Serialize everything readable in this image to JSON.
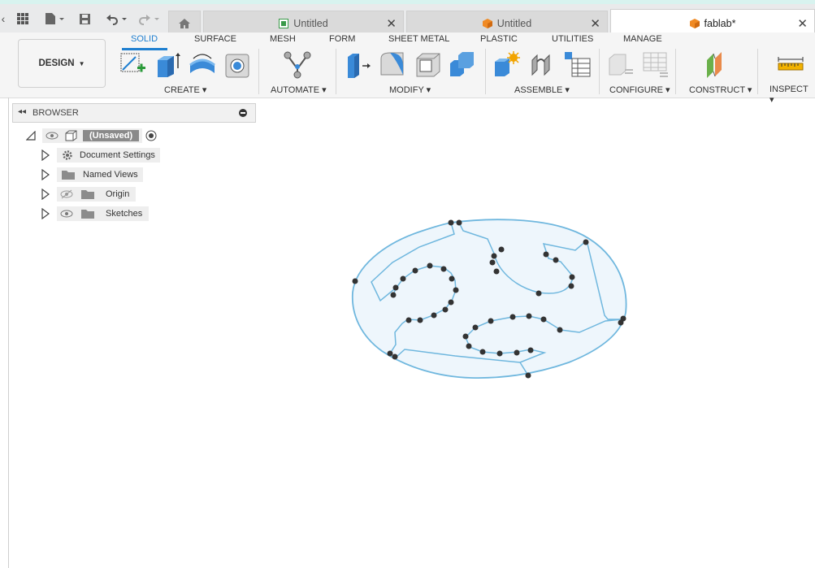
{
  "titlebar": {
    "tabs": [
      {
        "label": "Untitled"
      },
      {
        "label": "Untitled"
      },
      {
        "label": "fablab*"
      }
    ]
  },
  "toolbar": {
    "workspace": "DESIGN",
    "ribbon_tabs": [
      "SOLID",
      "SURFACE",
      "MESH",
      "FORM",
      "SHEET METAL",
      "PLASTIC",
      "UTILITIES",
      "MANAGE"
    ],
    "groups": [
      "CREATE",
      "AUTOMATE",
      "MODIFY",
      "ASSEMBLE",
      "CONFIGURE",
      "CONSTRUCT",
      "INSPECT"
    ]
  },
  "browser": {
    "title": "BROWSER",
    "root": "(Unsaved)",
    "items": [
      {
        "label": "Document Settings",
        "icon": "gear-icon"
      },
      {
        "label": "Named Views",
        "icon": "folder-icon"
      },
      {
        "label": "Origin",
        "icon": "folder-icon"
      },
      {
        "label": "Sketches",
        "icon": "folder-icon"
      }
    ]
  },
  "colors": {
    "accent": "#1f7fd0",
    "sketch_line": "#6fb7de",
    "sketch_fill": "#eef6fc",
    "point": "#333333"
  }
}
